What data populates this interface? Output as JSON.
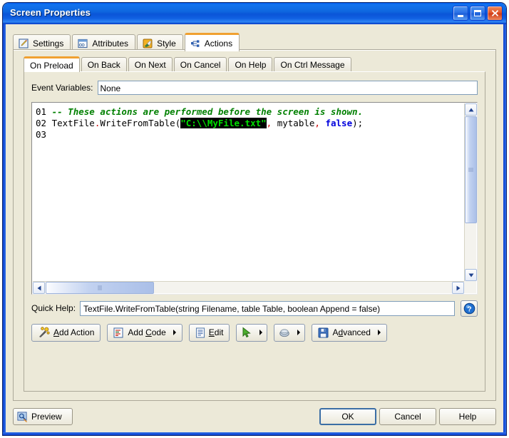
{
  "window": {
    "title": "Screen Properties",
    "controls": {
      "minimize": "minimize-button",
      "maximize": "maximize-button",
      "close": "close-button"
    }
  },
  "outer_tabs": [
    {
      "label": "Settings",
      "icon": "pencil-note-icon",
      "selected": false
    },
    {
      "label": "Attributes",
      "icon": "window-list-icon",
      "selected": false
    },
    {
      "label": "Style",
      "icon": "paint-brush-icon",
      "selected": false
    },
    {
      "label": "Actions",
      "icon": "node-tree-icon",
      "selected": true
    }
  ],
  "inner_tabs": [
    {
      "label": "On Preload",
      "selected": true
    },
    {
      "label": "On Back",
      "selected": false
    },
    {
      "label": "On Next",
      "selected": false
    },
    {
      "label": "On Cancel",
      "selected": false
    },
    {
      "label": "On Help",
      "selected": false
    },
    {
      "label": "On Ctrl Message",
      "selected": false
    }
  ],
  "event_variables": {
    "label": "Event Variables:",
    "value": "None",
    "placeholder": ""
  },
  "editor": {
    "lines": [
      {
        "number": "01",
        "text": "-- These actions are performed before the screen is shown."
      },
      {
        "number": "02",
        "text": "TextFile.WriteFromTable(\"C:\\\\MyFile.txt\", mytable, false);"
      },
      {
        "number": "03",
        "text": ""
      }
    ],
    "selection": "\"C:\\\\MyFile.txt\"",
    "colors": {
      "comment": "#008000",
      "punctuation": "#cc0000",
      "keyword": "#0000dd",
      "selection_bg": "#000000",
      "selection_fg": "#00e000",
      "background": "#ffffff"
    },
    "v_scroll_up": "scroll-up-arrow",
    "v_scroll_down": "scroll-down-arrow",
    "h_scroll_left": "scroll-left-arrow",
    "h_scroll_right": "scroll-right-arrow"
  },
  "quick_help": {
    "label": "Quick Help:",
    "value": "TextFile.WriteFromTable(string Filename, table Table, boolean Append = false)",
    "help_icon": "question-mark-icon"
  },
  "toolbar": [
    {
      "label": "Add Action",
      "accel": "A",
      "icon": "magic-wand-icon",
      "dropdown": false
    },
    {
      "label": "Add Code",
      "accel": "C",
      "icon": "code-list-icon",
      "dropdown": true
    },
    {
      "label": "Edit",
      "accel": "E",
      "icon": "document-icon",
      "dropdown": false
    },
    {
      "label": "",
      "accel": "",
      "icon": "green-cursor-icon",
      "dropdown": true
    },
    {
      "label": "",
      "accel": "",
      "icon": "globe-icon",
      "dropdown": true
    },
    {
      "label": "Advanced",
      "accel": "d",
      "icon": "save-disk-icon",
      "dropdown": true
    }
  ],
  "footer": {
    "preview": {
      "label": "Preview",
      "icon": "preview-screen-icon"
    },
    "ok": "OK",
    "cancel": "Cancel",
    "help": "Help"
  },
  "colors": {
    "title_bar": "#0a55d8",
    "dialog_face": "#ece9d8",
    "tab_selected_accent": "#f0a030",
    "field_border": "#7f9db9",
    "default_button_border": "#3b6ea5"
  }
}
